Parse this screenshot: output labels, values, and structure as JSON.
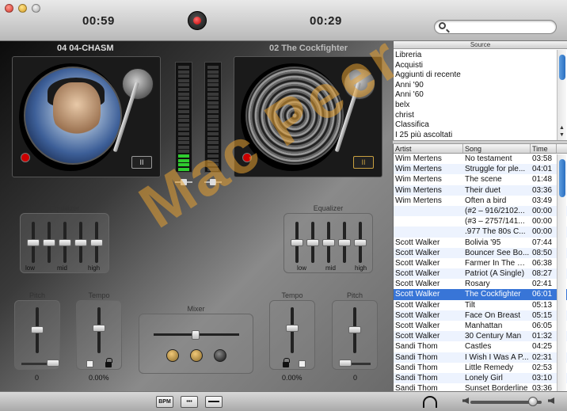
{
  "header": {
    "left_time": "00:59",
    "right_time": "00:29",
    "search_placeholder": ""
  },
  "decks": {
    "left_title": "04 04-CHASM",
    "right_title": "02 The Cockfighter",
    "pause_label": "II"
  },
  "left_eq": {
    "title": "Equalizer",
    "labels": [
      "low",
      "mid",
      "high"
    ]
  },
  "right_eq": {
    "title": "Equalizer",
    "labels": [
      "low",
      "mid",
      "high"
    ]
  },
  "pitch_left": {
    "title": "Pitch",
    "value": "0"
  },
  "tempo_left": {
    "title": "Tempo",
    "value": "0.00%"
  },
  "mixer": {
    "title": "Mixer"
  },
  "tempo_right": {
    "title": "Tempo",
    "value": "0.00%"
  },
  "pitch_right": {
    "title": "Pitch",
    "value": "0"
  },
  "source": {
    "title": "Source",
    "items": [
      "Libreria",
      "Acquisti",
      "Aggiunti di recente",
      "Anni '90",
      "Anni '60",
      "belx",
      "christ",
      "Classifica",
      "I 25 più ascoltati"
    ]
  },
  "tracks": {
    "headers": [
      "Artist",
      "Song",
      "Time"
    ],
    "rows": [
      [
        "Wim Mertens",
        "No testament",
        "03:58"
      ],
      [
        "Wim Mertens",
        "Struggle for ple...",
        "04:01"
      ],
      [
        "Wim Mertens",
        "The scene",
        "01:48"
      ],
      [
        "Wim Mertens",
        "Their duet",
        "03:36"
      ],
      [
        "Wim Mertens",
        "Often a bird",
        "03:49"
      ],
      [
        "",
        "(#2 – 916/2102...",
        "00:00"
      ],
      [
        "",
        "(#3 – 2757/141...",
        "00:00"
      ],
      [
        "",
        ".977 The 80s C...",
        "00:00"
      ],
      [
        "Scott Walker",
        "Bolivia '95",
        "07:44"
      ],
      [
        "Scott Walker",
        "Bouncer See Bo...",
        "08:50"
      ],
      [
        "Scott Walker",
        "Farmer In The City",
        "06:38"
      ],
      [
        "Scott Walker",
        "Patriot (A Single)",
        "08:27"
      ],
      [
        "Scott Walker",
        "Rosary",
        "02:41"
      ],
      [
        "Scott Walker",
        "The Cockfighter",
        "06:01"
      ],
      [
        "Scott Walker",
        "Tilt",
        "05:13"
      ],
      [
        "Scott Walker",
        "Face On Breast",
        "05:15"
      ],
      [
        "Scott Walker",
        "Manhattan",
        "06:05"
      ],
      [
        "Scott Walker",
        "30 Century Man",
        "01:32"
      ],
      [
        "Sandi Thom",
        "Castles",
        "04:25"
      ],
      [
        "Sandi Thom",
        "I Wish I Was A P...",
        "02:31"
      ],
      [
        "Sandi Thom",
        "Little Remedy",
        "02:53"
      ],
      [
        "Sandi Thom",
        "Lonely Girl",
        "03:10"
      ],
      [
        "Sandi Thom",
        "Sunset Borderline",
        "03:36"
      ]
    ],
    "selected_index": 13
  },
  "footer": {
    "bpm_label": "BPM",
    "dots_label": "•••",
    "volume_level": 0.88
  },
  "watermark": {
    "text": "Mac Peer"
  },
  "colors": {
    "selection": "#3875d7",
    "vu_on": "#2fcb2f",
    "record_red": "#c00000"
  }
}
